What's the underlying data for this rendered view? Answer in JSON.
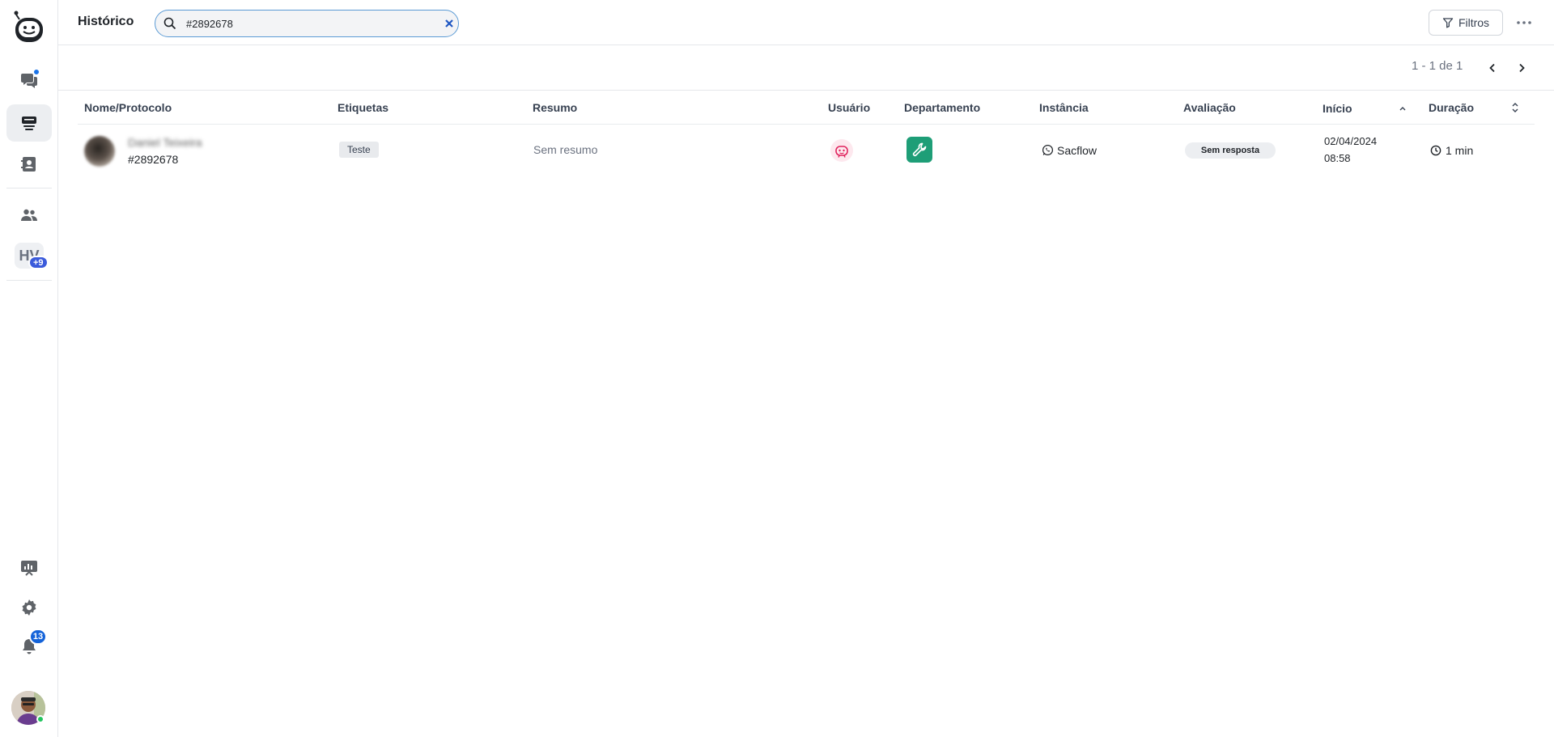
{
  "header": {
    "title": "Histórico",
    "search_value": "#2892678",
    "filters_label": "Filtros"
  },
  "sidebar": {
    "hv_initials": "HV",
    "hv_badge": "+9",
    "notifications_count": "13"
  },
  "pagination": {
    "range": "1 - 1 de 1"
  },
  "table": {
    "columns": [
      "Nome/Protocolo",
      "Etiquetas",
      "Resumo",
      "Usuário",
      "Departamento",
      "Instância",
      "Avaliação",
      "Início",
      "Duração"
    ],
    "rows": [
      {
        "name": "Daniel Teixeira",
        "protocol": "#2892678",
        "tag": "Teste",
        "summary": "Sem resumo",
        "instance": "Sacflow",
        "rating": "Sem resposta",
        "start_date": "02/04/2024",
        "start_time": "08:58",
        "duration": "1 min"
      }
    ]
  },
  "colors": {
    "accent_blue": "#1a73e8",
    "dept_green": "#1e9e77",
    "user_pink": "#e0245e",
    "badge_indigo": "#3b5bdb"
  }
}
